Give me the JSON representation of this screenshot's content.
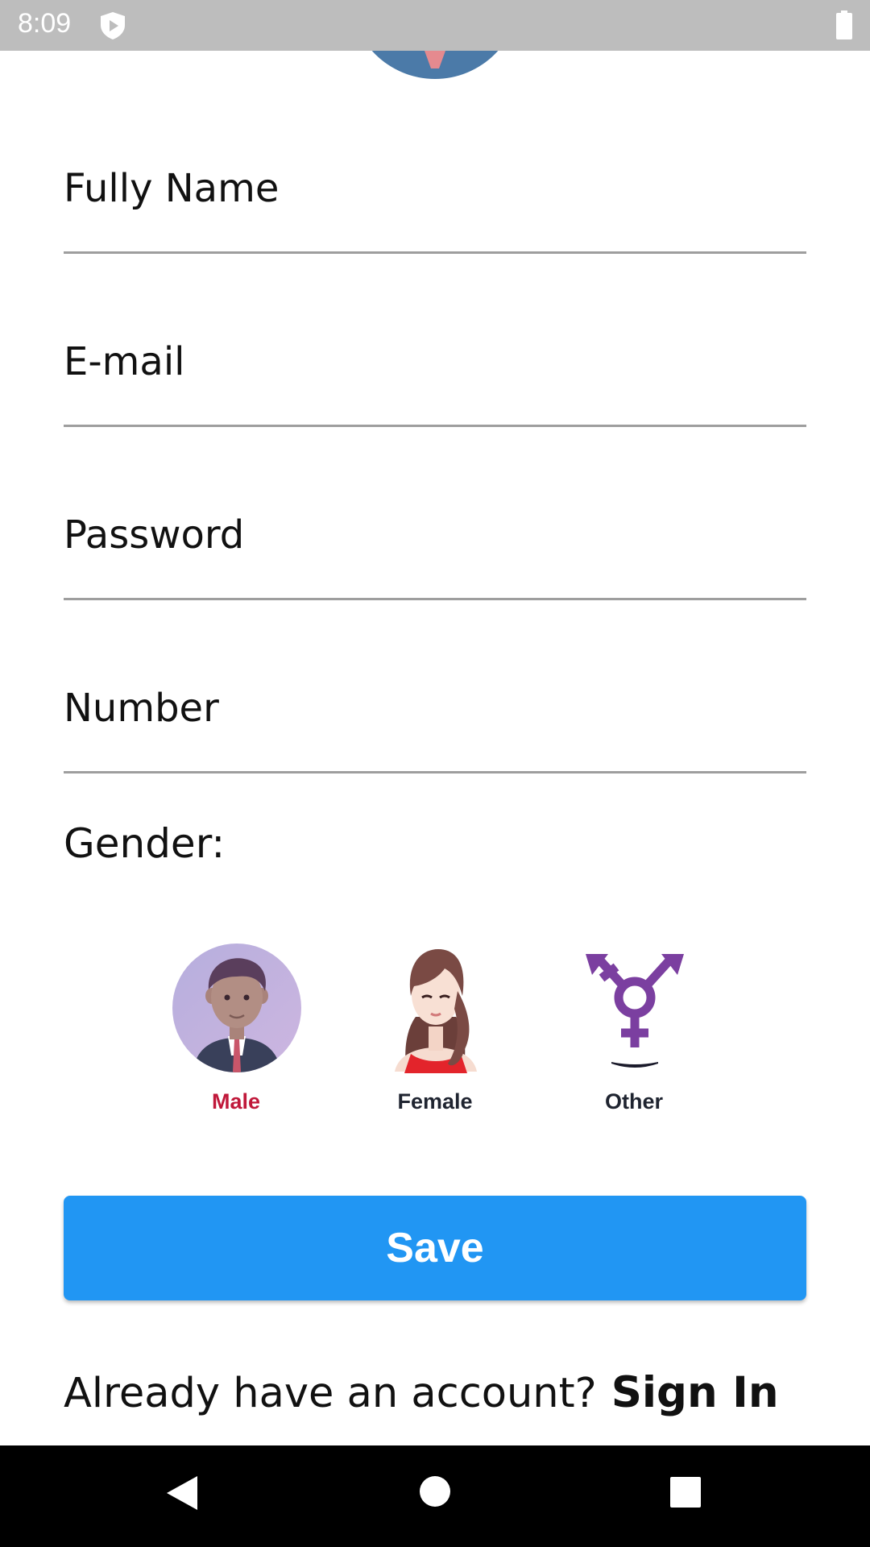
{
  "status_bar": {
    "time": "8:09",
    "icons": [
      "shield-icon",
      "battery-icon"
    ]
  },
  "form": {
    "full_name_placeholder": "Fully Name",
    "email_placeholder": "E-mail",
    "password_placeholder": "Password",
    "number_placeholder": "Number",
    "gender_label": "Gender:"
  },
  "gender_options": [
    {
      "label": "Male",
      "icon": "male-avatar-icon",
      "selected": true
    },
    {
      "label": "Female",
      "icon": "female-avatar-icon",
      "selected": false
    },
    {
      "label": "Other",
      "icon": "transgender-symbol-icon",
      "selected": false
    }
  ],
  "save_label": "Save",
  "signin": {
    "prompt": "Already have an account?",
    "link": "Sign In"
  },
  "colors": {
    "primary": "#2196f3",
    "selected_text": "#c0183a",
    "other_icon": "#7b3fa0"
  },
  "nav_bar": {
    "icons": [
      "back-icon",
      "home-icon",
      "recent-apps-icon"
    ]
  }
}
